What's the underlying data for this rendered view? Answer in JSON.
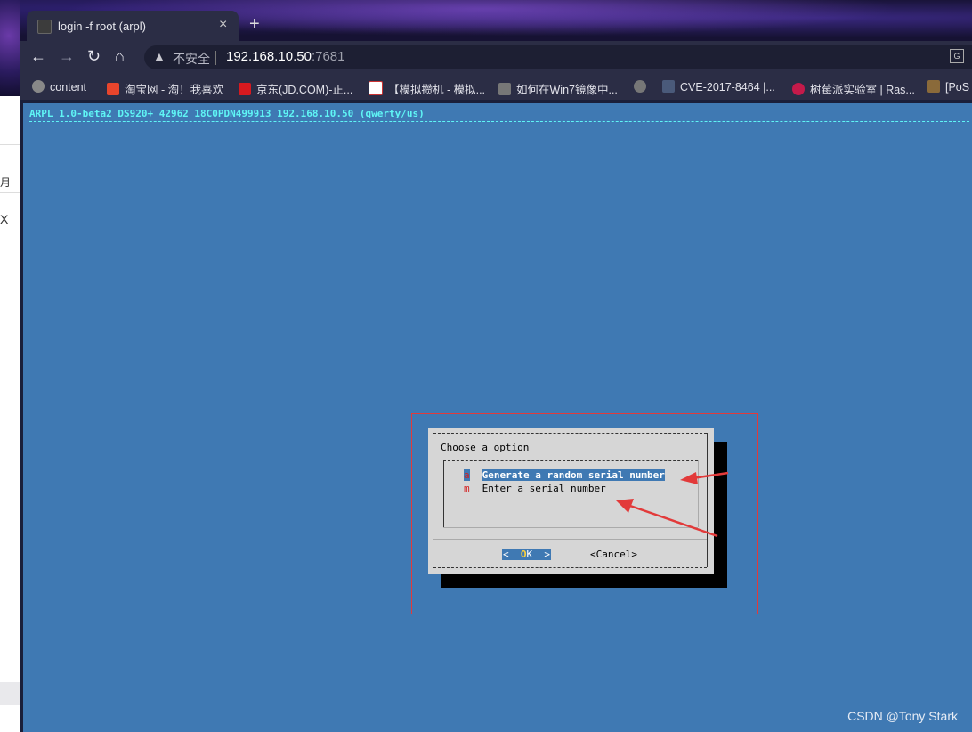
{
  "left_window": {
    "chars": [
      "月",
      "X"
    ]
  },
  "tab": {
    "title": "login -f root (arpl)",
    "close": "×"
  },
  "new_tab": "+",
  "toolbar": {
    "back": "←",
    "forward": "→",
    "reload": "↻",
    "home": "⌂",
    "security_icon": "warning-triangle-icon",
    "insecure_label": "不安全",
    "url_host": "192.168.10.50",
    "url_port": ":7681"
  },
  "bookmarks": [
    {
      "label": "content",
      "color": "#888888"
    },
    {
      "label": "淘宝网 - 淘！我喜欢",
      "color": "#e8452c"
    },
    {
      "label": "京东(JD.COM)-正...",
      "color": "#d7191f"
    },
    {
      "label": "【模拟攒机 - 模拟...",
      "color": "#ffffff"
    },
    {
      "label": "如何在Win7镜像中...",
      "color": "#777777"
    },
    {
      "label": "",
      "color": "#777777"
    },
    {
      "label": "CVE-2017-8464 |...",
      "color": "#4a5a7a"
    },
    {
      "label": "树莓派实验室 | Ras...",
      "color": "#c51a4a"
    },
    {
      "label": "[PoS",
      "color": "#8a6a3a"
    }
  ],
  "terminal": {
    "status_line": "ARPL 1.0-beta2 DS920+ 42962 18C0PDN499913 192.168.10.50 (qwerty/us)"
  },
  "dialog": {
    "title": "Choose a option",
    "items": [
      {
        "key": "a",
        "label": "Generate a random serial number",
        "selected": true
      },
      {
        "key": "m",
        "label": "Enter a serial number",
        "selected": false
      }
    ],
    "ok": {
      "left": "<  ",
      "key": "O",
      "rest": "K  >"
    },
    "cancel": "<Cancel>"
  },
  "watermark": "CSDN @Tony Stark",
  "colors": {
    "terminal_bg": "#3f79b3",
    "annotation": "#e23a3a",
    "status_text": "#5ff5f5"
  }
}
